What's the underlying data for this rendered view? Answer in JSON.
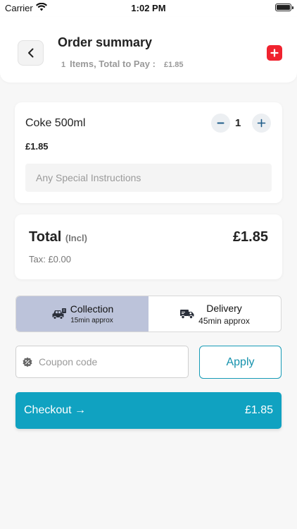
{
  "status_bar": {
    "carrier": "Carrier",
    "time": "1:02 PM"
  },
  "header": {
    "title": "Order summary",
    "item_count": "1",
    "items_label": "Items, Total to Pay :",
    "total": "£1.85"
  },
  "cart": {
    "items": [
      {
        "name": "Coke 500ml",
        "price": "£1.85",
        "quantity": "1"
      }
    ],
    "instructions_placeholder": "Any Special Instructions",
    "instructions_value": ""
  },
  "totals": {
    "label": "Total",
    "incl_label": "(Incl)",
    "amount": "£1.85",
    "tax_text": "Tax: £0.00"
  },
  "order_method": {
    "selected": "collection",
    "options": [
      {
        "id": "collection",
        "title": "Collection",
        "subtitle": "15min approx"
      },
      {
        "id": "delivery",
        "title": "Delivery",
        "subtitle": "45min approx"
      }
    ]
  },
  "coupon": {
    "placeholder": "Coupon code",
    "value": "",
    "apply_label": "Apply"
  },
  "checkout": {
    "label": "Checkout →",
    "amount": "£1.85"
  },
  "colors": {
    "accent": "#10a2c1",
    "selected_option": "#bcc3da",
    "add_button": "#f0232f",
    "qty_icon": "#1f5d8a"
  },
  "icons": {
    "back": "chevron-left-icon",
    "add": "plus-icon",
    "minus": "minus-icon",
    "plus": "plus-icon",
    "collection": "car-icon",
    "delivery": "delivery-truck-icon",
    "coupon": "discount-badge-icon",
    "wifi": "wifi-icon",
    "battery": "battery-icon"
  }
}
